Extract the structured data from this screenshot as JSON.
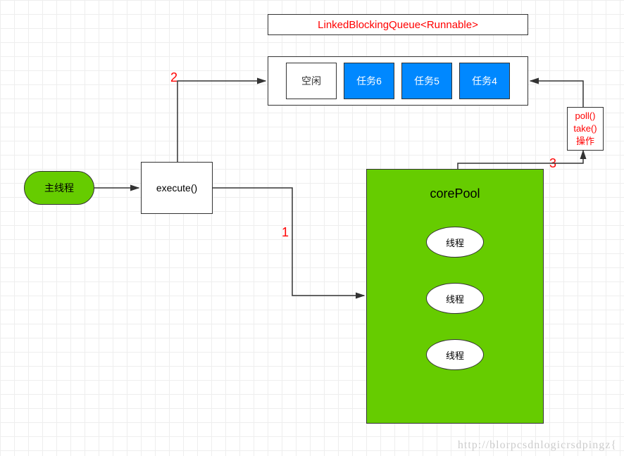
{
  "main_thread": "主线程",
  "execute": "execute()",
  "queue": {
    "title": "LinkedBlockingQueue<Runnable>",
    "slots": {
      "empty": "空闲",
      "t6": "任务6",
      "t5": "任务5",
      "t4": "任务4"
    }
  },
  "corepool": {
    "title": "corePool",
    "thread": "线程"
  },
  "poll": {
    "line1": "poll()",
    "line2": "take()",
    "line3": "操作"
  },
  "labels": {
    "n1": "1",
    "n2": "2",
    "n3": "3"
  },
  "watermark": "http://blorpcsdnlogicrsdpingz{",
  "chart_data": {
    "type": "flow-diagram",
    "nodes": [
      {
        "id": "main",
        "label": "主线程",
        "kind": "start",
        "color": "#66cc00"
      },
      {
        "id": "exec",
        "label": "execute()",
        "kind": "process"
      },
      {
        "id": "queue",
        "label": "LinkedBlockingQueue<Runnable>",
        "kind": "queue",
        "cells": [
          "空闲",
          "任务6",
          "任务5",
          "任务4"
        ]
      },
      {
        "id": "pool",
        "label": "corePool",
        "kind": "pool",
        "threads": [
          "线程",
          "线程",
          "线程"
        ],
        "color": "#66cc00"
      },
      {
        "id": "poll",
        "label": "poll() take() 操作",
        "kind": "annotation"
      }
    ],
    "edges": [
      {
        "from": "main",
        "to": "exec"
      },
      {
        "from": "exec",
        "to": "queue",
        "label": "2"
      },
      {
        "from": "exec",
        "to": "pool",
        "label": "1"
      },
      {
        "from": "pool",
        "to": "queue",
        "label": "3",
        "via": "poll"
      }
    ]
  }
}
